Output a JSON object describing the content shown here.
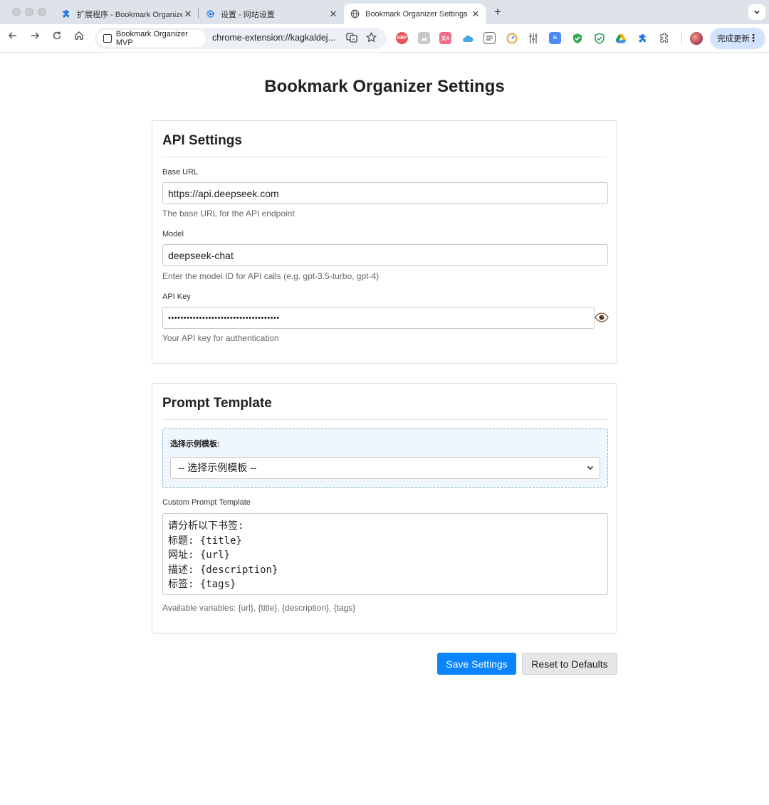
{
  "browser": {
    "tabs": [
      {
        "title": "扩展程序 - Bookmark Organizer MVP",
        "icon": "puzzle-icon",
        "active": false
      },
      {
        "title": "设置 - 网站设置",
        "icon": "gear-icon",
        "active": false
      },
      {
        "title": "Bookmark Organizer Settings",
        "icon": "globe-icon",
        "active": true
      }
    ],
    "close_glyph": "✕",
    "new_tab_glyph": "+",
    "address": {
      "site_chip": "Bookmark Organizer MVP",
      "url": "chrome-extension://kagkaldej..."
    },
    "extensions": [
      {
        "icon": "abp-icon",
        "color": "#e8545c",
        "label": "ABP"
      },
      {
        "icon": "image-icon",
        "color": "#c8c8c8",
        "label": ""
      },
      {
        "icon": "translate-ext-icon",
        "color": "#f06a8a",
        "label": "文A"
      },
      {
        "icon": "cloud-icon",
        "color": "#4aa8e8",
        "label": ""
      },
      {
        "icon": "reader-icon",
        "color": "#666666",
        "label": ""
      },
      {
        "icon": "gauge-icon",
        "color": "#e6a23c",
        "label": ""
      },
      {
        "icon": "tools-icon",
        "color": "#777777",
        "label": ""
      },
      {
        "icon": "google-translate-icon",
        "color": "#4a8af4",
        "label": "G"
      },
      {
        "icon": "shield-check-icon",
        "color": "#34a853",
        "label": "✓"
      },
      {
        "icon": "shield-green-icon",
        "color": "#2e9e5b",
        "label": "✓"
      },
      {
        "icon": "drive-icon",
        "color": "#f4b400",
        "label": "▲"
      },
      {
        "icon": "puzzle-blue-icon",
        "color": "#1a73e8",
        "label": ""
      },
      {
        "icon": "extensions-icon",
        "color": "#888888",
        "label": ""
      }
    ],
    "update_button": "完成更新"
  },
  "page": {
    "title": "Bookmark Organizer Settings",
    "api_settings": {
      "heading": "API Settings",
      "base_url": {
        "label": "Base URL",
        "value": "https://api.deepseek.com",
        "help": "The base URL for the API endpoint"
      },
      "model": {
        "label": "Model",
        "value": "deepseek-chat",
        "help": "Enter the model ID for API calls (e.g. gpt-3.5-turbo, gpt-4)"
      },
      "api_key": {
        "label": "API Key",
        "value": "••••••••••••••••••••••••••••••••••••",
        "help": "Your API key for authentication"
      }
    },
    "prompt_template": {
      "heading": "Prompt Template",
      "example_label": "选择示例模板:",
      "example_selected": "-- 选择示例模板 --",
      "custom_label": "Custom Prompt Template",
      "lines": [
        "请分析以下书签:",
        "标题: {title}",
        "网址: {url}",
        "描述: {description}",
        "标签: {tags}"
      ],
      "variables_help": "Available variables: {url}, {title}, {description}, {tags}"
    },
    "buttons": {
      "save": "Save Settings",
      "reset": "Reset to Defaults"
    }
  }
}
